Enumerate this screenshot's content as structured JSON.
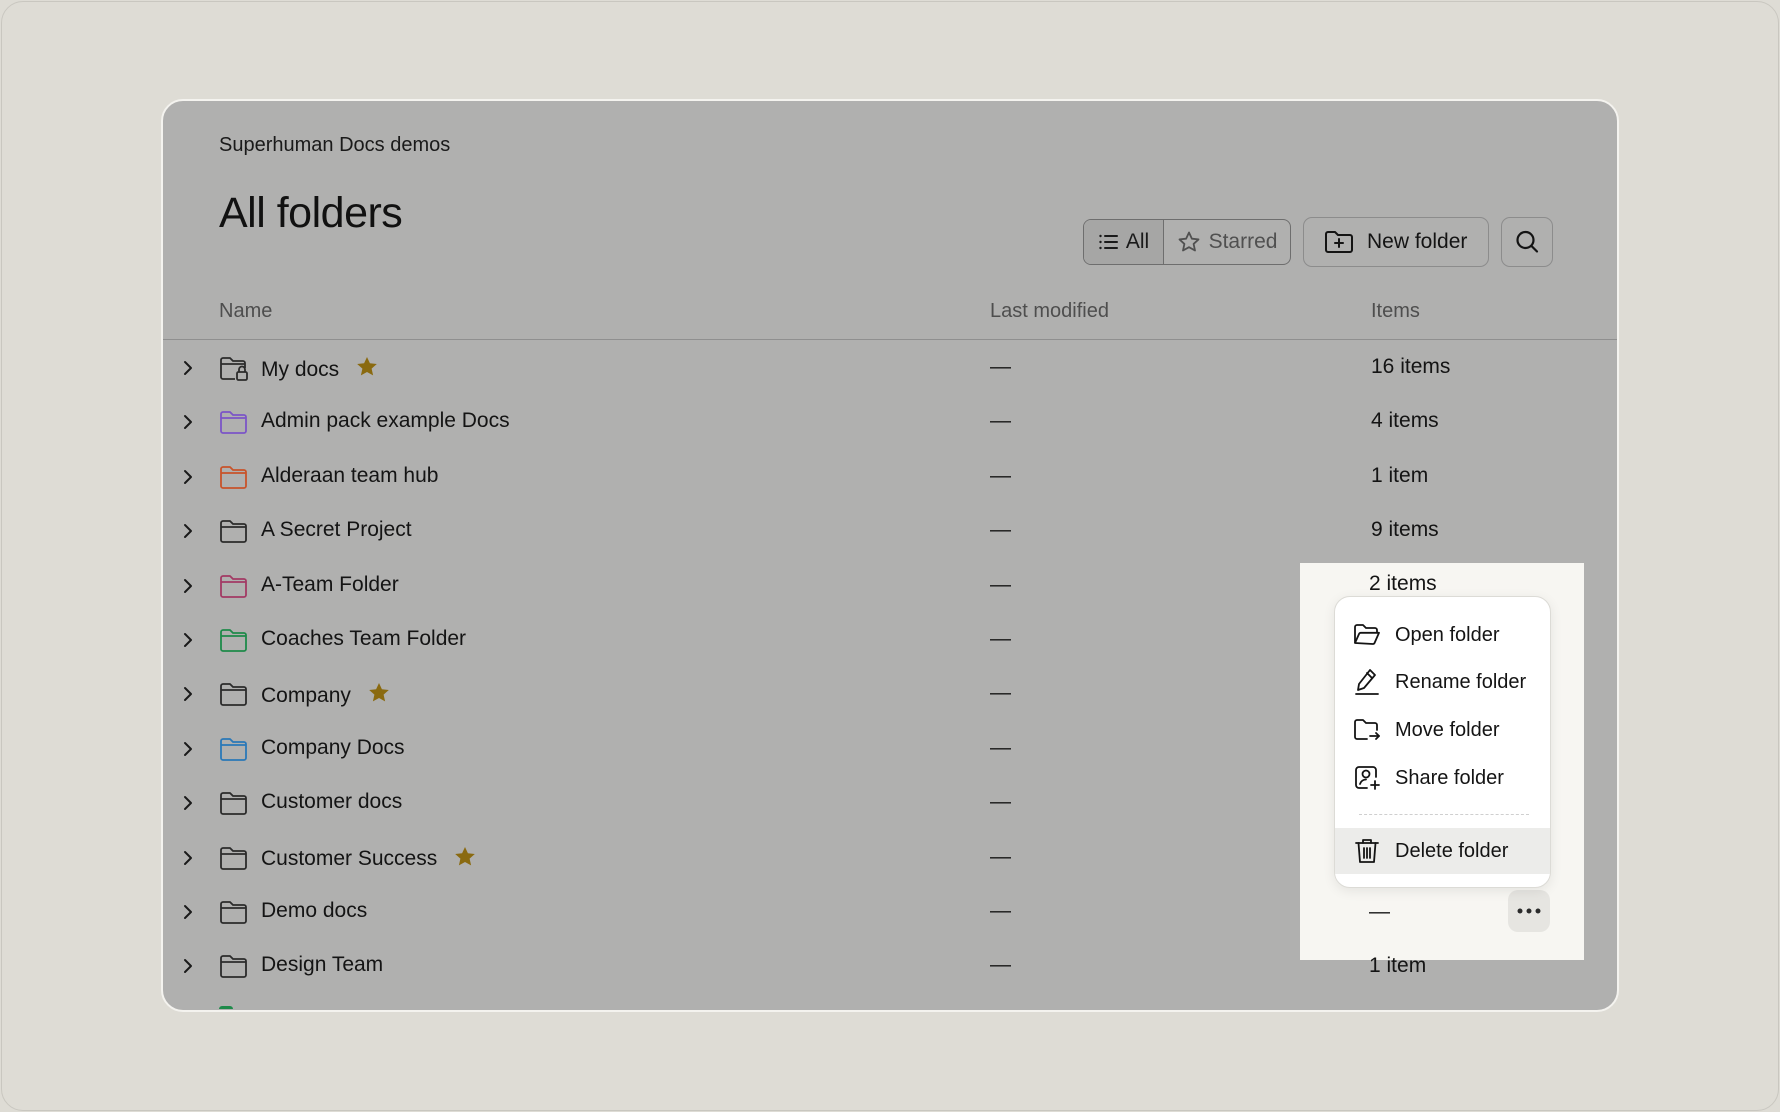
{
  "workspace_name": "Superhuman Docs demos",
  "page_title": "All folders",
  "filter": {
    "all_label": "All",
    "starred_label": "Starred",
    "active": "All"
  },
  "new_folder_label": "New folder",
  "columns": {
    "name": "Name",
    "last_modified": "Last modified",
    "items": "Items"
  },
  "rows": [
    {
      "name": "My docs",
      "modified": "—",
      "items": "16 items",
      "starred": true,
      "icon": "folder-lock-icon",
      "color": "#2b2b2b"
    },
    {
      "name": "Admin pack example Docs",
      "modified": "—",
      "items": "4 items",
      "starred": false,
      "icon": "folder-icon",
      "color": "#7b55c7"
    },
    {
      "name": "Alderaan team hub",
      "modified": "—",
      "items": "1 item",
      "starred": false,
      "icon": "folder-icon",
      "color": "#c8532a"
    },
    {
      "name": "A Secret Project",
      "modified": "—",
      "items": "9 items",
      "starred": false,
      "icon": "folder-icon",
      "color": "#2b2b2b"
    },
    {
      "name": "A-Team Folder",
      "modified": "—",
      "items": "2 items",
      "starred": false,
      "icon": "folder-icon",
      "color": "#a23a64"
    },
    {
      "name": "Coaches Team Folder",
      "modified": "—",
      "items": "",
      "starred": false,
      "icon": "folder-icon",
      "color": "#1e8a4a"
    },
    {
      "name": "Company",
      "modified": "—",
      "items": "",
      "starred": true,
      "icon": "folder-icon",
      "color": "#2b2b2b"
    },
    {
      "name": "Company Docs",
      "modified": "—",
      "items": "",
      "starred": false,
      "icon": "folder-icon",
      "color": "#2a78b8"
    },
    {
      "name": "Customer docs",
      "modified": "—",
      "items": "",
      "starred": false,
      "icon": "folder-icon",
      "color": "#2b2b2b"
    },
    {
      "name": "Customer Success",
      "modified": "—",
      "items": "",
      "starred": true,
      "icon": "folder-icon",
      "color": "#2b2b2b"
    },
    {
      "name": "Demo docs",
      "modified": "—",
      "items": "—",
      "starred": false,
      "icon": "folder-icon",
      "color": "#2b2b2b"
    },
    {
      "name": "Design Team",
      "modified": "—",
      "items": "1 item",
      "starred": false,
      "icon": "folder-icon",
      "color": "#2b2b2b"
    }
  ],
  "context_menu": {
    "items": [
      {
        "label": "Open folder",
        "icon": "folder-open-icon"
      },
      {
        "label": "Rename folder",
        "icon": "pen-icon"
      },
      {
        "label": "Move folder",
        "icon": "folder-move-icon"
      },
      {
        "label": "Share folder",
        "icon": "user-add-icon"
      },
      {
        "label": "Delete folder",
        "icon": "trash-icon"
      }
    ]
  },
  "colors": {
    "star": "#8a6a10",
    "overlay": "#b0b0af",
    "highlight": "#f7f6f2"
  }
}
